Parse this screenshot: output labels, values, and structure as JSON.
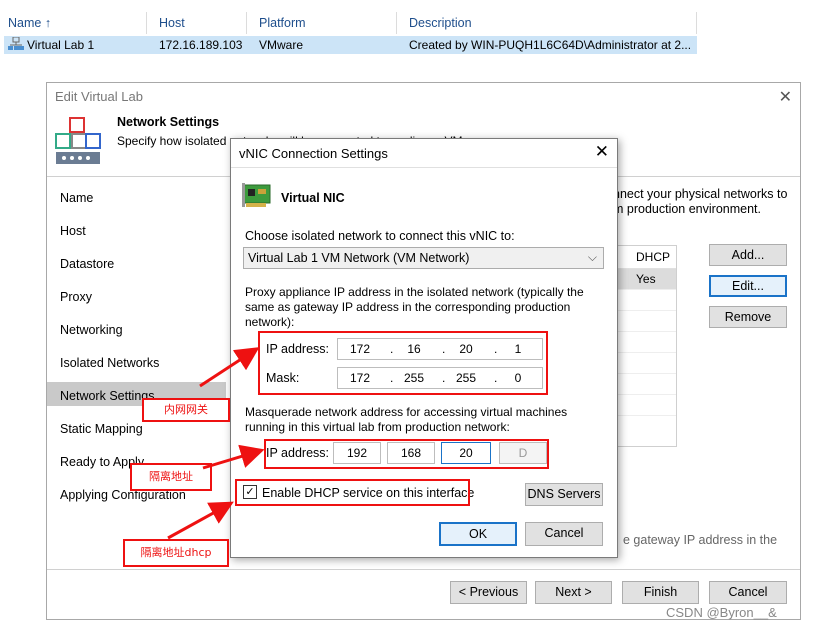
{
  "vm_list": {
    "headers": {
      "name": "Name",
      "sort_icon": "arrow-up-icon",
      "host": "Host",
      "platform": "Platform",
      "description": "Description"
    },
    "row": {
      "name": "Virtual Lab 1",
      "host": "172.16.189.103",
      "platform": "VMware",
      "description": "Created by WIN-PUQH1L6C64D\\Administrator at 2..."
    }
  },
  "main_dialog": {
    "title": "Edit Virtual Lab",
    "header_title": "Network Settings",
    "header_subtitle": "Specify how isolated",
    "header_subtitle_tail": "networks will be connected to appliance VM",
    "nav": [
      "Name",
      "Host",
      "Datastore",
      "Proxy",
      "Networking",
      "Isolated Networks",
      "Network Settings",
      "Static Mapping",
      "Ready to Apply",
      "Applying Configuration"
    ],
    "selected_nav": "Network Settings",
    "right_text_1": "nnect your physical networks to",
    "right_text_2": "m production environment.",
    "grid_header": "DHCP",
    "grid_value": "Yes",
    "buttons": {
      "add": "Add...",
      "edit": "Edit...",
      "remove": "Remove"
    },
    "bottom_hint": "e gateway IP address in the",
    "footer": {
      "previous": "< Previous",
      "next": "Next >",
      "finish": "Finish",
      "cancel": "Cancel"
    }
  },
  "vnic_dialog": {
    "title": "vNIC Connection Settings",
    "section": "Virtual NIC",
    "choose_label": "Choose isolated network to connect this vNIC to:",
    "network_selected": "Virtual Lab 1 VM Network (VM Network)",
    "proxy_text_1": "Proxy appliance IP address in the isolated network (typically the",
    "proxy_text_2": "same as gateway IP address in the corresponding production",
    "proxy_text_3": "network):",
    "ip_label": "IP address:",
    "ip": [
      "172",
      "16",
      "20",
      "1"
    ],
    "mask_label": "Mask:",
    "mask": [
      "172",
      "255",
      "255",
      "0"
    ],
    "masq_text_1": "Masquerade network address for accessing virtual machines",
    "masq_text_2": "running in this virtual lab from production network:",
    "masq_label": "IP address:",
    "masq": [
      "192",
      "168",
      "20",
      "D"
    ],
    "dhcp_label": "Enable DHCP service on this interface",
    "dhcp_checked": true,
    "dns_button": "DNS Servers",
    "ok": "OK",
    "cancel": "Cancel"
  },
  "annotations": {
    "inner_gateway": "内网网关",
    "isolated_address": "隔离地址",
    "isolated_dhcp": "隔离地址dhcp"
  },
  "watermark": "CSDN @Byron__&",
  "colors": {
    "accent": "#1a73c8",
    "annotation": "#ee1111",
    "selection": "#cce4f7"
  }
}
